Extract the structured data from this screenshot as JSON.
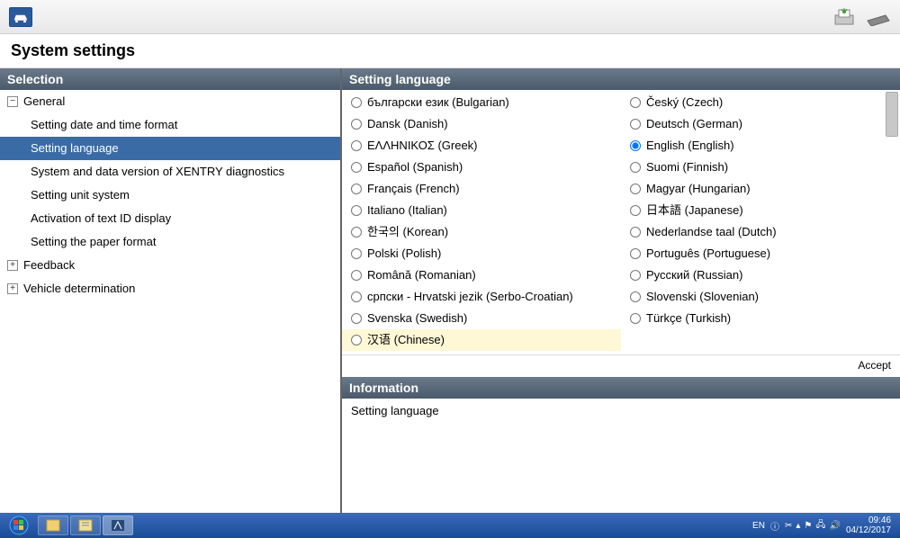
{
  "page_title": "System settings",
  "left": {
    "header": "Selection",
    "nodes": [
      {
        "label": "General",
        "level": 0,
        "expanded": true,
        "hasChildren": true
      },
      {
        "label": "Setting date and time format",
        "level": 1
      },
      {
        "label": "Setting language",
        "level": 1,
        "selected": true
      },
      {
        "label": "System and data version of XENTRY diagnostics",
        "level": 1
      },
      {
        "label": "Setting unit system",
        "level": 1
      },
      {
        "label": "Activation of text ID display",
        "level": 1
      },
      {
        "label": "Setting the paper format",
        "level": 1
      },
      {
        "label": "Feedback",
        "level": 0,
        "expanded": false,
        "hasChildren": true
      },
      {
        "label": "Vehicle determination",
        "level": 0,
        "expanded": false,
        "hasChildren": true
      }
    ]
  },
  "right": {
    "header": "Setting language",
    "languages": [
      {
        "label": "български език (Bulgarian)"
      },
      {
        "label": "Český (Czech)"
      },
      {
        "label": "Dansk (Danish)"
      },
      {
        "label": "Deutsch (German)"
      },
      {
        "label": "ΕΛΛΗΝΙΚΟΣ (Greek)"
      },
      {
        "label": "English (English)",
        "selected": true
      },
      {
        "label": "Español (Spanish)"
      },
      {
        "label": "Suomi (Finnish)"
      },
      {
        "label": "Français (French)"
      },
      {
        "label": "Magyar (Hungarian)"
      },
      {
        "label": "Italiano (Italian)"
      },
      {
        "label": "日本語 (Japanese)"
      },
      {
        "label": "한국의 (Korean)"
      },
      {
        "label": "Nederlandse taal (Dutch)"
      },
      {
        "label": "Polski (Polish)"
      },
      {
        "label": "Português (Portuguese)"
      },
      {
        "label": "Română (Romanian)"
      },
      {
        "label": "Русский (Russian)"
      },
      {
        "label": "српски - Hrvatski jezik (Serbo-Croatian)"
      },
      {
        "label": "Slovenski (Slovenian)"
      },
      {
        "label": "Svenska (Swedish)"
      },
      {
        "label": "Türkçe (Turkish)"
      },
      {
        "label": "汉语 (Chinese)",
        "highlight": true
      }
    ],
    "accept": "Accept"
  },
  "info": {
    "header": "Information",
    "body": "Setting language"
  },
  "taskbar": {
    "lang": "EN",
    "time": "09:46",
    "date": "04/12/2017"
  }
}
